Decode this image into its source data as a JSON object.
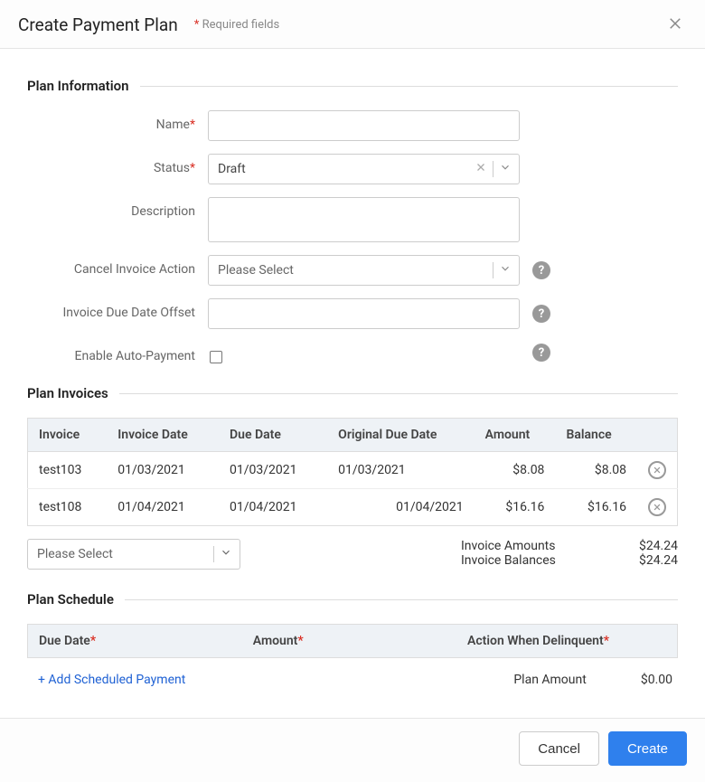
{
  "header": {
    "title": "Create Payment Plan",
    "required_hint": "Required fields"
  },
  "sections": {
    "plan_info": "Plan Information",
    "plan_invoices": "Plan Invoices",
    "plan_schedule": "Plan Schedule"
  },
  "form": {
    "name_label": "Name",
    "name_value": "",
    "status_label": "Status",
    "status_value": "Draft",
    "description_label": "Description",
    "description_value": "",
    "cancel_action_label": "Cancel Invoice Action",
    "cancel_action_placeholder": "Please Select",
    "offset_label": "Invoice Due Date Offset",
    "offset_value": "",
    "autopay_label": "Enable Auto-Payment"
  },
  "invoices": {
    "headers": {
      "invoice": "Invoice",
      "invoice_date": "Invoice Date",
      "due_date": "Due Date",
      "original_due_date": "Original Due Date",
      "amount": "Amount",
      "balance": "Balance"
    },
    "rows": [
      {
        "invoice": "test103",
        "invoice_date": "01/03/2021",
        "due_date": "01/03/2021",
        "original_due_date": "01/03/2021",
        "amount": "$8.08",
        "balance": "$8.08"
      },
      {
        "invoice": "test108",
        "invoice_date": "01/04/2021",
        "due_date": "01/04/2021",
        "original_due_date": "01/04/2021",
        "amount": "$16.16",
        "balance": "$16.16"
      }
    ],
    "add_placeholder": "Please Select",
    "totals": {
      "amounts_label": "Invoice Amounts",
      "amounts_value": "$24.24",
      "balances_label": "Invoice Balances",
      "balances_value": "$24.24"
    }
  },
  "schedule": {
    "headers": {
      "due_date": "Due Date",
      "amount": "Amount",
      "action": "Action When Delinquent"
    },
    "add_link": "+ Add Scheduled Payment",
    "plan_amount_label": "Plan Amount",
    "plan_amount_value": "$0.00"
  },
  "footer": {
    "cancel": "Cancel",
    "create": "Create"
  }
}
